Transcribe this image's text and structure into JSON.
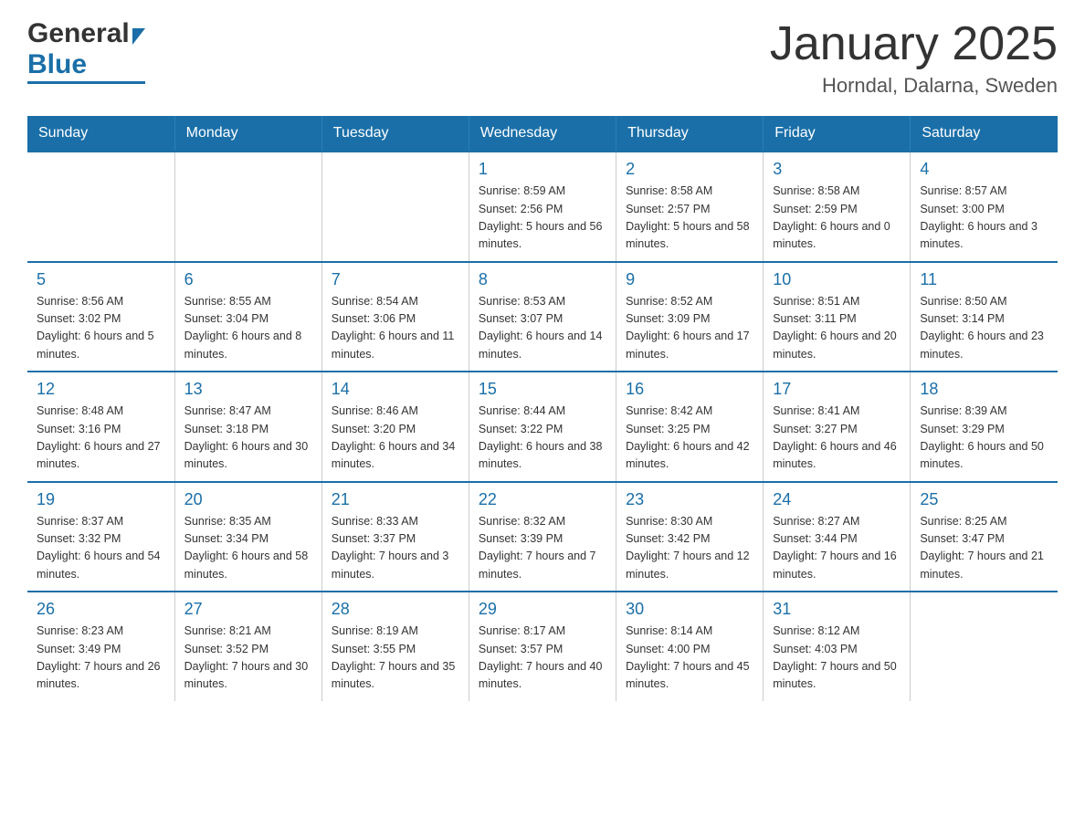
{
  "header": {
    "logo_general": "General",
    "logo_blue": "Blue",
    "title": "January 2025",
    "subtitle": "Horndal, Dalarna, Sweden"
  },
  "days_of_week": [
    "Sunday",
    "Monday",
    "Tuesday",
    "Wednesday",
    "Thursday",
    "Friday",
    "Saturday"
  ],
  "weeks": [
    [
      {
        "day": "",
        "info": ""
      },
      {
        "day": "",
        "info": ""
      },
      {
        "day": "",
        "info": ""
      },
      {
        "day": "1",
        "info": "Sunrise: 8:59 AM\nSunset: 2:56 PM\nDaylight: 5 hours\nand 56 minutes."
      },
      {
        "day": "2",
        "info": "Sunrise: 8:58 AM\nSunset: 2:57 PM\nDaylight: 5 hours\nand 58 minutes."
      },
      {
        "day": "3",
        "info": "Sunrise: 8:58 AM\nSunset: 2:59 PM\nDaylight: 6 hours\nand 0 minutes."
      },
      {
        "day": "4",
        "info": "Sunrise: 8:57 AM\nSunset: 3:00 PM\nDaylight: 6 hours\nand 3 minutes."
      }
    ],
    [
      {
        "day": "5",
        "info": "Sunrise: 8:56 AM\nSunset: 3:02 PM\nDaylight: 6 hours\nand 5 minutes."
      },
      {
        "day": "6",
        "info": "Sunrise: 8:55 AM\nSunset: 3:04 PM\nDaylight: 6 hours\nand 8 minutes."
      },
      {
        "day": "7",
        "info": "Sunrise: 8:54 AM\nSunset: 3:06 PM\nDaylight: 6 hours\nand 11 minutes."
      },
      {
        "day": "8",
        "info": "Sunrise: 8:53 AM\nSunset: 3:07 PM\nDaylight: 6 hours\nand 14 minutes."
      },
      {
        "day": "9",
        "info": "Sunrise: 8:52 AM\nSunset: 3:09 PM\nDaylight: 6 hours\nand 17 minutes."
      },
      {
        "day": "10",
        "info": "Sunrise: 8:51 AM\nSunset: 3:11 PM\nDaylight: 6 hours\nand 20 minutes."
      },
      {
        "day": "11",
        "info": "Sunrise: 8:50 AM\nSunset: 3:14 PM\nDaylight: 6 hours\nand 23 minutes."
      }
    ],
    [
      {
        "day": "12",
        "info": "Sunrise: 8:48 AM\nSunset: 3:16 PM\nDaylight: 6 hours\nand 27 minutes."
      },
      {
        "day": "13",
        "info": "Sunrise: 8:47 AM\nSunset: 3:18 PM\nDaylight: 6 hours\nand 30 minutes."
      },
      {
        "day": "14",
        "info": "Sunrise: 8:46 AM\nSunset: 3:20 PM\nDaylight: 6 hours\nand 34 minutes."
      },
      {
        "day": "15",
        "info": "Sunrise: 8:44 AM\nSunset: 3:22 PM\nDaylight: 6 hours\nand 38 minutes."
      },
      {
        "day": "16",
        "info": "Sunrise: 8:42 AM\nSunset: 3:25 PM\nDaylight: 6 hours\nand 42 minutes."
      },
      {
        "day": "17",
        "info": "Sunrise: 8:41 AM\nSunset: 3:27 PM\nDaylight: 6 hours\nand 46 minutes."
      },
      {
        "day": "18",
        "info": "Sunrise: 8:39 AM\nSunset: 3:29 PM\nDaylight: 6 hours\nand 50 minutes."
      }
    ],
    [
      {
        "day": "19",
        "info": "Sunrise: 8:37 AM\nSunset: 3:32 PM\nDaylight: 6 hours\nand 54 minutes."
      },
      {
        "day": "20",
        "info": "Sunrise: 8:35 AM\nSunset: 3:34 PM\nDaylight: 6 hours\nand 58 minutes."
      },
      {
        "day": "21",
        "info": "Sunrise: 8:33 AM\nSunset: 3:37 PM\nDaylight: 7 hours\nand 3 minutes."
      },
      {
        "day": "22",
        "info": "Sunrise: 8:32 AM\nSunset: 3:39 PM\nDaylight: 7 hours\nand 7 minutes."
      },
      {
        "day": "23",
        "info": "Sunrise: 8:30 AM\nSunset: 3:42 PM\nDaylight: 7 hours\nand 12 minutes."
      },
      {
        "day": "24",
        "info": "Sunrise: 8:27 AM\nSunset: 3:44 PM\nDaylight: 7 hours\nand 16 minutes."
      },
      {
        "day": "25",
        "info": "Sunrise: 8:25 AM\nSunset: 3:47 PM\nDaylight: 7 hours\nand 21 minutes."
      }
    ],
    [
      {
        "day": "26",
        "info": "Sunrise: 8:23 AM\nSunset: 3:49 PM\nDaylight: 7 hours\nand 26 minutes."
      },
      {
        "day": "27",
        "info": "Sunrise: 8:21 AM\nSunset: 3:52 PM\nDaylight: 7 hours\nand 30 minutes."
      },
      {
        "day": "28",
        "info": "Sunrise: 8:19 AM\nSunset: 3:55 PM\nDaylight: 7 hours\nand 35 minutes."
      },
      {
        "day": "29",
        "info": "Sunrise: 8:17 AM\nSunset: 3:57 PM\nDaylight: 7 hours\nand 40 minutes."
      },
      {
        "day": "30",
        "info": "Sunrise: 8:14 AM\nSunset: 4:00 PM\nDaylight: 7 hours\nand 45 minutes."
      },
      {
        "day": "31",
        "info": "Sunrise: 8:12 AM\nSunset: 4:03 PM\nDaylight: 7 hours\nand 50 minutes."
      },
      {
        "day": "",
        "info": ""
      }
    ]
  ],
  "colors": {
    "header_bg": "#1a6fa8",
    "header_text": "#ffffff",
    "day_number": "#1a6fa8",
    "border": "#cccccc",
    "row_border": "#1a6fa8"
  }
}
